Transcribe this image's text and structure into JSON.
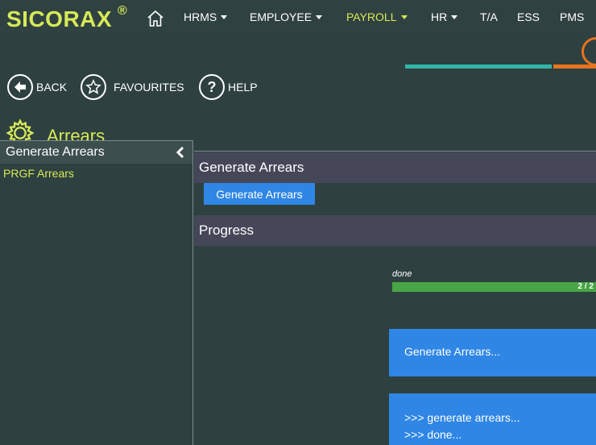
{
  "app": {
    "brand": "SICORAX",
    "brand_mark": "®"
  },
  "nav": {
    "items": [
      {
        "label": "HRMS",
        "dropdown": true
      },
      {
        "label": "EMPLOYEE",
        "dropdown": true
      },
      {
        "label": "PAYROLL",
        "dropdown": true,
        "active": true
      },
      {
        "label": "HR",
        "dropdown": true
      },
      {
        "label": "T/A",
        "dropdown": false
      },
      {
        "label": "ESS",
        "dropdown": false
      },
      {
        "label": "PMS",
        "dropdown": false
      }
    ]
  },
  "actions": {
    "back": "BACK",
    "favourites": "FAVOURITES",
    "help": "HELP",
    "help_icon_glyph": "?"
  },
  "page": {
    "title": "Arrears"
  },
  "sidebar": {
    "header": "Generate Arrears",
    "items": [
      {
        "label": "PRGF Arrears"
      }
    ]
  },
  "generate_panel": {
    "title": "Generate Arrears",
    "button_label": "Generate Arrears"
  },
  "progress_panel": {
    "title": "Progress",
    "status": "done",
    "count_text": "2 / 2",
    "completed": 2,
    "total": 2,
    "log_title": "Generate Arrears...",
    "log_lines": [
      ">>> generate arrears...",
      ">>> done..."
    ]
  },
  "colors": {
    "accent": "#d7e957",
    "background": "#2e4140",
    "panel_header": "#454759",
    "button": "#2f86e5",
    "progress": "#48a545",
    "teal": "#32b5a9",
    "orange": "#e8731e"
  }
}
